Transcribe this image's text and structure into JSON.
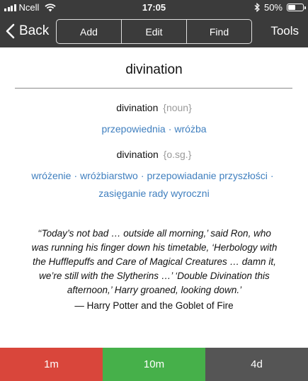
{
  "status_bar": {
    "carrier": "Ncell",
    "time": "17:05",
    "battery_text": "50%",
    "battery_level": 0.5
  },
  "nav": {
    "back_label": "Back",
    "segments": [
      "Add",
      "Edit",
      "Find"
    ],
    "tools_label": "Tools"
  },
  "headword": "divination",
  "entries": [
    {
      "term": "divination",
      "pos": "{noun}",
      "translations": [
        "przepowiednia",
        "wróżba"
      ]
    },
    {
      "term": "divination",
      "pos": "{o.sg.}",
      "translations": [
        "wróżenie",
        "wróżbiarstwo",
        "przepowiadanie przyszłości",
        "zasięganie rady wyroczni"
      ]
    }
  ],
  "separator": "·",
  "quote": {
    "lines": [
      "‘‘Today’s not bad … outside all morning,’ said Ron, who",
      "was running his finger down his timetable, ‘Herbology with",
      "the Hufflepuffs and Care of Magical Creatures … damn it,",
      "we’re still with the Slytherins …’ ‘Double Divination this",
      "afternoon,’ Harry groaned, looking down.’"
    ],
    "source": "— Harry Potter and the Goblet of Fire"
  },
  "bottom_buttons": [
    {
      "label": "1m",
      "color": "#d9463b"
    },
    {
      "label": "10m",
      "color": "#46b04a"
    },
    {
      "label": "4d",
      "color": "#555555"
    }
  ]
}
